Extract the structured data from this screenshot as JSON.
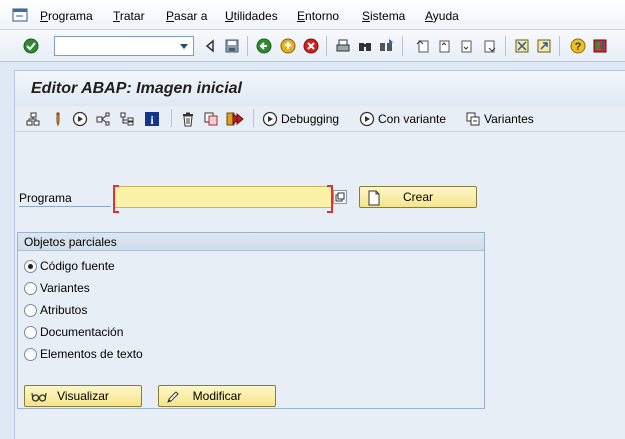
{
  "menubar": {
    "items": [
      {
        "pre": "",
        "acc": "P",
        "post": "rograma"
      },
      {
        "pre": "",
        "acc": "T",
        "post": "ratar"
      },
      {
        "pre": "",
        "acc": "P",
        "post": "asar a"
      },
      {
        "pre": "",
        "acc": "U",
        "post": "tilidades"
      },
      {
        "pre": "",
        "acc": "E",
        "post": "ntorno"
      },
      {
        "pre": "",
        "acc": "S",
        "post": "istema"
      },
      {
        "pre": "",
        "acc": "A",
        "post": "yuda"
      }
    ]
  },
  "toolbar": {
    "command_value": ""
  },
  "header": {
    "title": "Editor ABAP: Imagen inicial"
  },
  "app_toolbar": {
    "debugging_label": "Debugging",
    "con_variante_label": "Con variante",
    "variantes_label": "Variantes"
  },
  "form": {
    "programa_label": "Programa",
    "programa_value": "",
    "crear_label": "Crear"
  },
  "objetos": {
    "title": "Objetos parciales",
    "options": [
      {
        "label": "Código fuente",
        "selected": true
      },
      {
        "label": "Variantes",
        "selected": false
      },
      {
        "label": "Atributos",
        "selected": false
      },
      {
        "label": "Documentación",
        "selected": false
      },
      {
        "label": "Elementos de texto",
        "selected": false
      }
    ],
    "visualizar_label": "Visualizar",
    "modificar_label": "Modificar"
  },
  "colors": {
    "required_field": "#fbf1a8",
    "button": "#f5e58a",
    "background": "#dfe9f5"
  }
}
